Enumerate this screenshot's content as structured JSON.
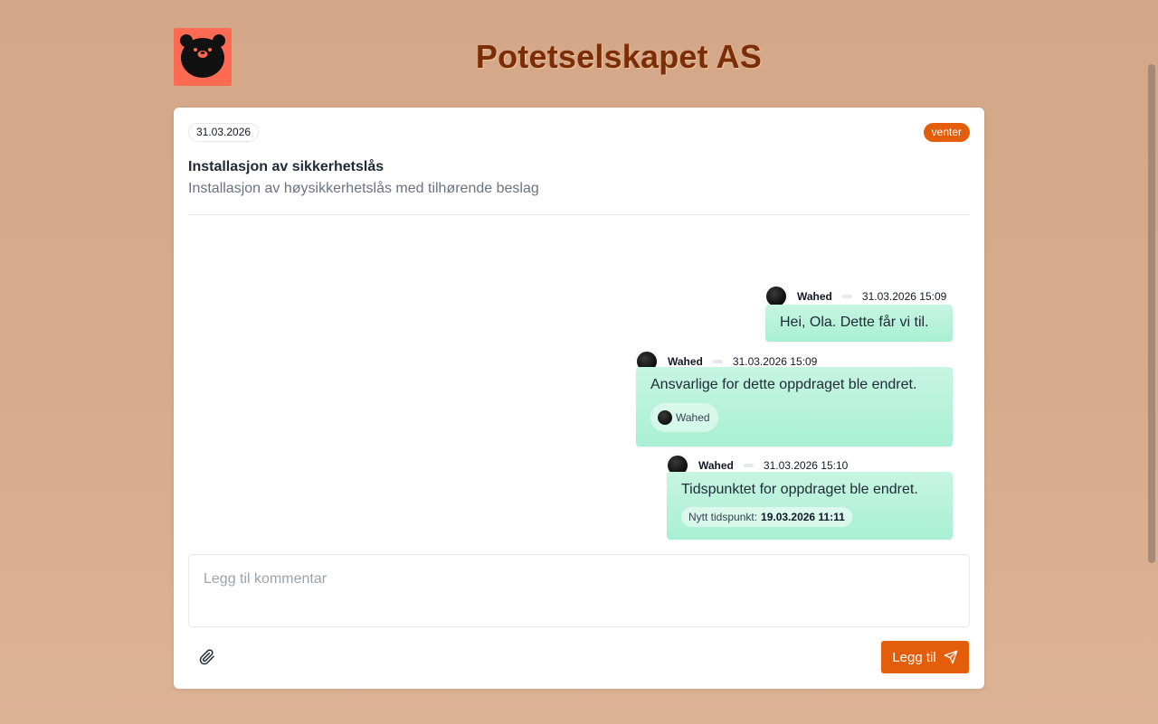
{
  "header": {
    "company_name": "Potetselskapet AS",
    "logo_icon": "bear-face-logo-icon",
    "logo_bg": "#ff6b52"
  },
  "task": {
    "date": "31.03.2026",
    "status": "venter",
    "status_color": "#e35d0a",
    "title": "Installasjon av sikkerhetslås",
    "description": "Installasjon av høysikkerhetslås med tilhørende beslag"
  },
  "messages": [
    {
      "author": "Wahed",
      "timestamp": "31.03.2026 15:09",
      "text": "Hei, Ola. Dette får vi til."
    },
    {
      "author": "Wahed",
      "timestamp": "31.03.2026 15:09",
      "text": "Ansvarlige for dette oppdraget ble endret.",
      "assignee": "Wahed"
    },
    {
      "author": "Wahed",
      "timestamp": "31.03.2026 15:10",
      "text": "Tidspunktet for oppdraget ble endret.",
      "new_time_label": "Nytt tidspunkt:",
      "new_time_value": "19.03.2026 11:11"
    }
  ],
  "comment": {
    "placeholder": "Legg til kommentar",
    "value": ""
  },
  "actions": {
    "attach_icon": "paperclip-icon",
    "submit_label": "Legg til",
    "submit_icon": "send-icon"
  },
  "colors": {
    "accent": "#e35d0a",
    "bubble": "#b5f2d9",
    "title": "#7a2d06"
  }
}
